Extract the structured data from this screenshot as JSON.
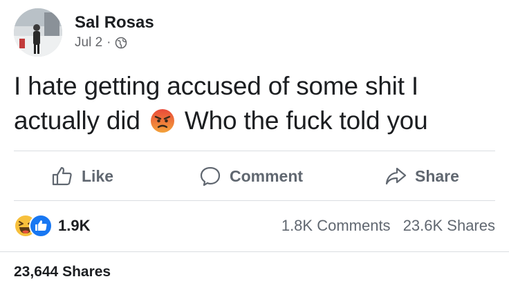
{
  "post": {
    "author": "Sal Rosas",
    "date": "Jul 2",
    "separator": "·",
    "privacy_icon": "globe-icon",
    "text_line1": "I hate getting accused of some shit I",
    "text_line2_part1": "actually did",
    "text_line2_emoji": "angry-face-icon",
    "text_line2_part2": "Who the fuck told you"
  },
  "actions": {
    "like_label": "Like",
    "comment_label": "Comment",
    "share_label": "Share"
  },
  "stats": {
    "reaction_icons": [
      "haha-icon",
      "like-icon"
    ],
    "reaction_count": "1.9K",
    "comments": "1.8K Comments",
    "shares": "23.6K Shares"
  },
  "footer": {
    "shares_total": "23,644 Shares"
  },
  "colors": {
    "text": "#1c1e21",
    "muted": "#606770",
    "divider": "#dadde1",
    "like_blue": "#1877f2",
    "haha_yellow": "#f7c03c",
    "angry_red": "#e8533a"
  }
}
